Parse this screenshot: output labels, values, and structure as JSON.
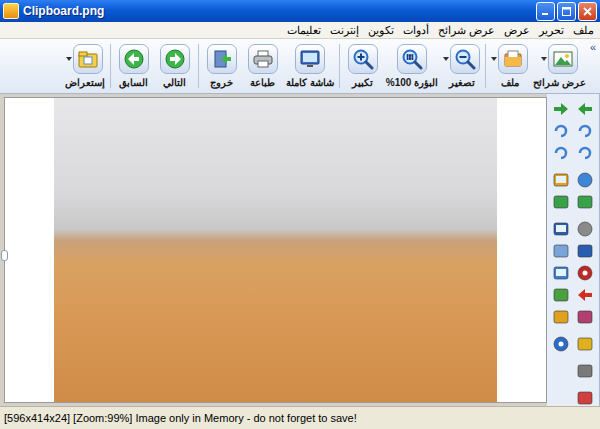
{
  "window": {
    "title": "Clipboard.png"
  },
  "menu": [
    "ملف",
    "تحرير",
    "عرض",
    "عرض شرائح",
    "أدوات",
    "تكوين",
    "إنترنت",
    "تعليمات"
  ],
  "toolbar": {
    "overflow": "»",
    "groups": [
      [
        {
          "label": "عرض شرائح",
          "dropdown": true
        },
        {
          "label": "ملف",
          "dropdown": true
        }
      ],
      [
        {
          "label": "تصغير",
          "dropdown": true
        },
        {
          "label": "البؤرة 100%",
          "dropdown": false
        },
        {
          "label": "تكبير",
          "dropdown": false
        }
      ],
      [
        {
          "label": "شاشة كاملة",
          "dropdown": false
        },
        {
          "label": "طباعة",
          "dropdown": false
        },
        {
          "label": "خروج",
          "dropdown": false
        }
      ],
      [
        {
          "label": "التالي",
          "dropdown": false
        },
        {
          "label": "السابق",
          "dropdown": false
        }
      ],
      [
        {
          "label": "إستعراض",
          "dropdown": true
        }
      ]
    ]
  },
  "status_bar": {
    "text": "[596x414x24] [Zoom:99%] Image only in Memory - do not forget to save!"
  }
}
